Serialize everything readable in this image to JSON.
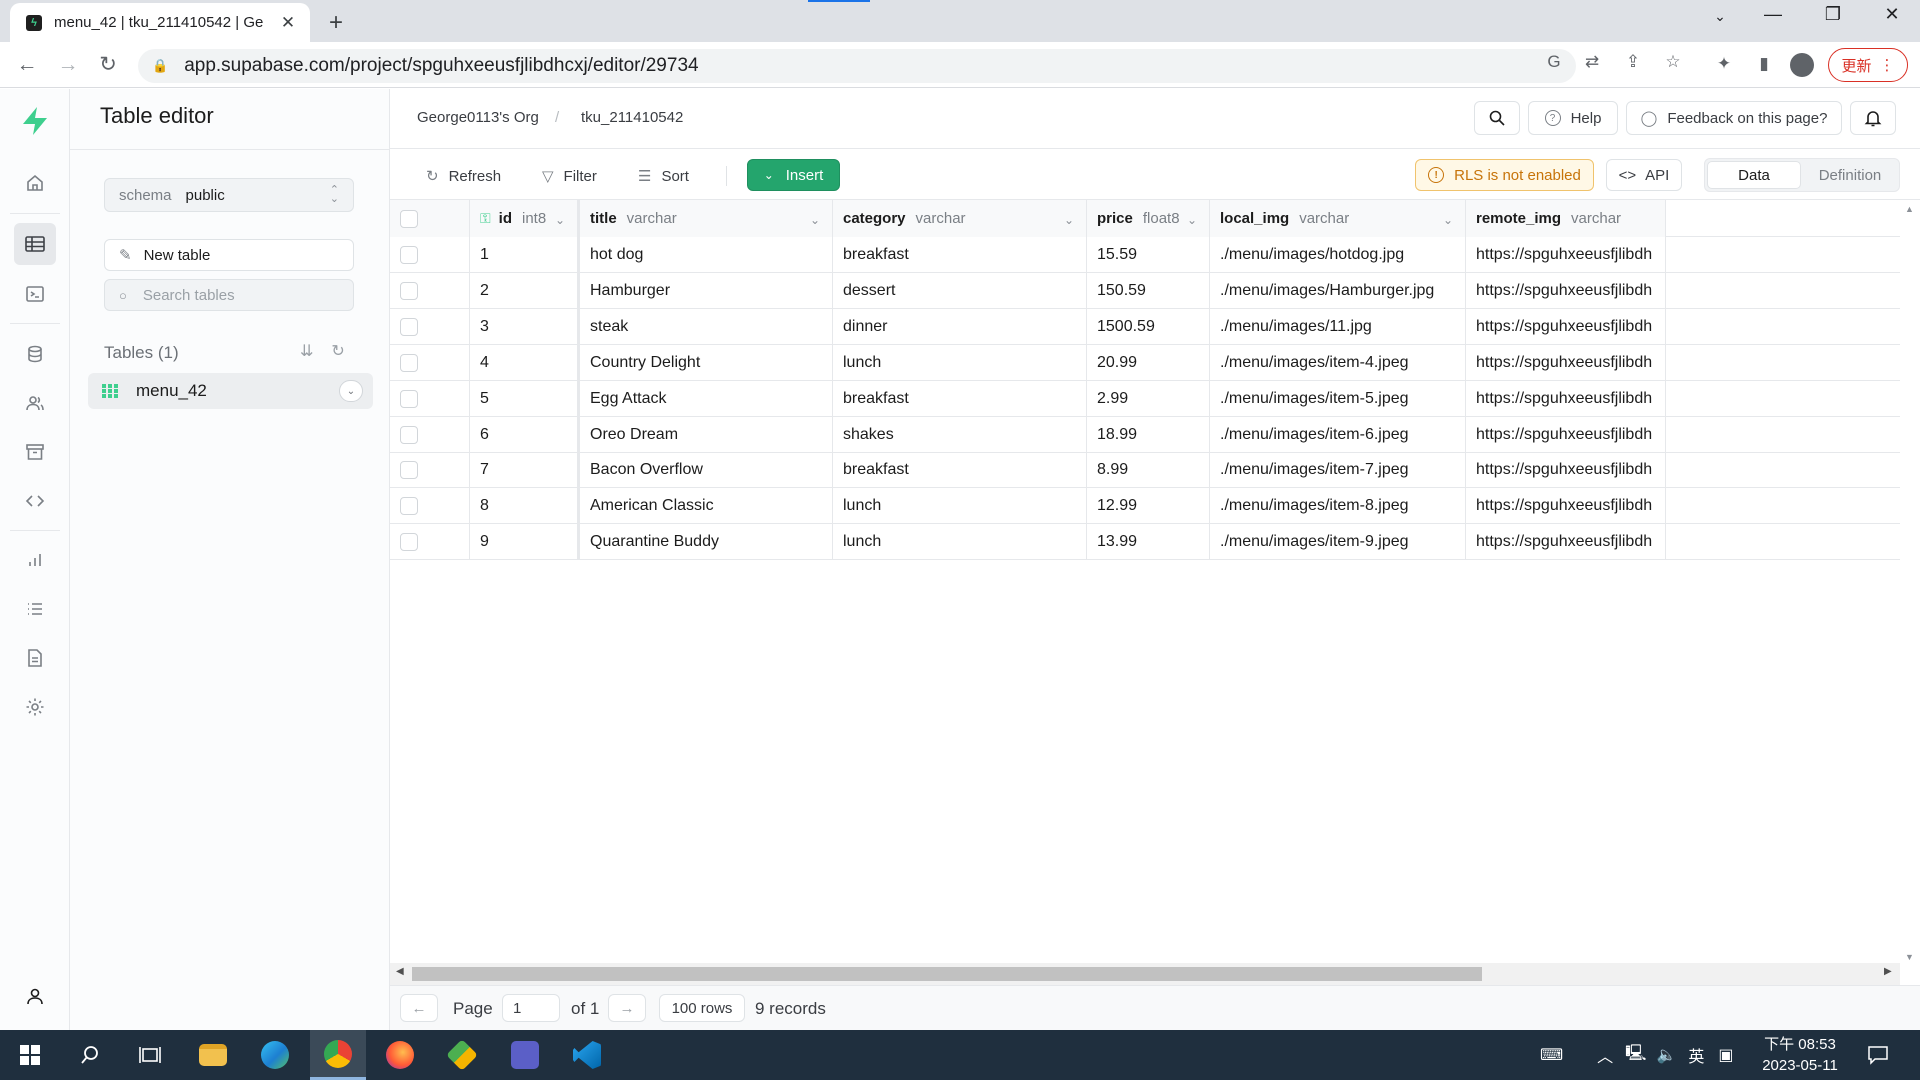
{
  "browser": {
    "tab_title": "menu_42 | tku_211410542 | Ge",
    "url": "app.supabase.com/project/spguhxeeusfjlibdhcxj/editor/29734",
    "update_label": "更新"
  },
  "sidebar": {
    "title": "Table editor",
    "schema_label": "schema",
    "schema_value": "public",
    "new_table_label": "New table",
    "search_placeholder": "Search tables",
    "tables_header": "Tables (1)",
    "tables": [
      {
        "name": "menu_42"
      }
    ]
  },
  "topbar": {
    "org": "George0113's Org",
    "project": "tku_211410542",
    "help_label": "Help",
    "feedback_label": "Feedback on this page?"
  },
  "actions": {
    "refresh_label": "Refresh",
    "filter_label": "Filter",
    "sort_label": "Sort",
    "insert_label": "Insert",
    "rls_label": "RLS is not enabled",
    "api_label": "API",
    "data_label": "Data",
    "definition_label": "Definition"
  },
  "grid": {
    "columns": [
      {
        "name": "id",
        "type": "int8"
      },
      {
        "name": "title",
        "type": "varchar"
      },
      {
        "name": "category",
        "type": "varchar"
      },
      {
        "name": "price",
        "type": "float8"
      },
      {
        "name": "local_img",
        "type": "varchar"
      },
      {
        "name": "remote_img",
        "type": "varchar"
      }
    ],
    "rows": [
      [
        "1",
        "hot dog",
        "breakfast",
        "15.59",
        "./menu/images/hotdog.jpg",
        "https://spguhxeeusfjlibdh"
      ],
      [
        "2",
        "Hamburger",
        "dessert",
        "150.59",
        "./menu/images/Hamburger.jpg",
        "https://spguhxeeusfjlibdh"
      ],
      [
        "3",
        "steak",
        "dinner",
        "1500.59",
        "./menu/images/11.jpg",
        "https://spguhxeeusfjlibdh"
      ],
      [
        "4",
        "Country Delight",
        "lunch",
        "20.99",
        "./menu/images/item-4.jpeg",
        "https://spguhxeeusfjlibdh"
      ],
      [
        "5",
        "Egg Attack",
        "breakfast",
        "2.99",
        "./menu/images/item-5.jpeg",
        "https://spguhxeeusfjlibdh"
      ],
      [
        "6",
        "Oreo Dream",
        "shakes",
        "18.99",
        "./menu/images/item-6.jpeg",
        "https://spguhxeeusfjlibdh"
      ],
      [
        "7",
        "Bacon Overflow",
        "breakfast",
        "8.99",
        "./menu/images/item-7.jpeg",
        "https://spguhxeeusfjlibdh"
      ],
      [
        "8",
        "American Classic",
        "lunch",
        "12.99",
        "./menu/images/item-8.jpeg",
        "https://spguhxeeusfjlibdh"
      ],
      [
        "9",
        "Quarantine Buddy",
        "lunch",
        "13.99",
        "./menu/images/item-9.jpeg",
        "https://spguhxeeusfjlibdh"
      ]
    ]
  },
  "footer": {
    "page_label": "Page",
    "page_value": "1",
    "of_label": "of 1",
    "rows_label": "100 rows",
    "records_label": "9 records"
  },
  "taskbar": {
    "ime_label": "英",
    "time": "下午 08:53",
    "date": "2023-05-11"
  },
  "colors": {
    "brand": "#3ecf8e",
    "insert": "#24a56d",
    "warning": "#c7740a",
    "chrome_update": "#d93025"
  }
}
